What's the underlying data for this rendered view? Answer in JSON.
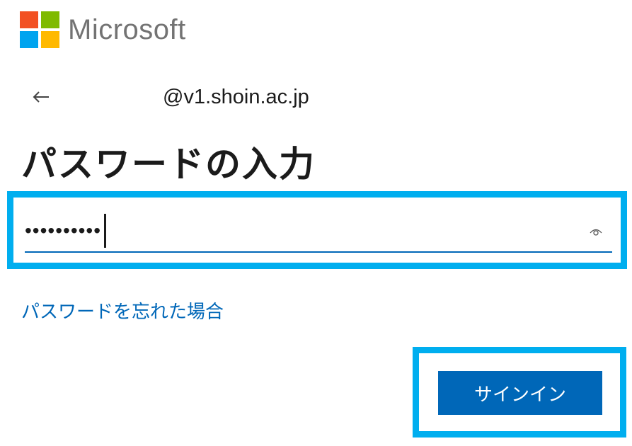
{
  "brand": {
    "name": "Microsoft",
    "logo_colors": [
      "#f25022",
      "#7fba00",
      "#00a4ef",
      "#ffb900"
    ]
  },
  "identity": {
    "back_icon": "arrow-left-icon",
    "account": "@v1.shoin.ac.jp"
  },
  "page": {
    "title": "パスワードの入力"
  },
  "password_field": {
    "value": "••••••••••",
    "reveal_icon": "eye-icon"
  },
  "links": {
    "forgot_password": "パスワードを忘れた場合"
  },
  "actions": {
    "signin_label": "サインイン"
  },
  "colors": {
    "accent": "#0067b8",
    "highlight_border": "#00aeef",
    "text": "#1b1b1b",
    "brand_text": "#737373"
  }
}
